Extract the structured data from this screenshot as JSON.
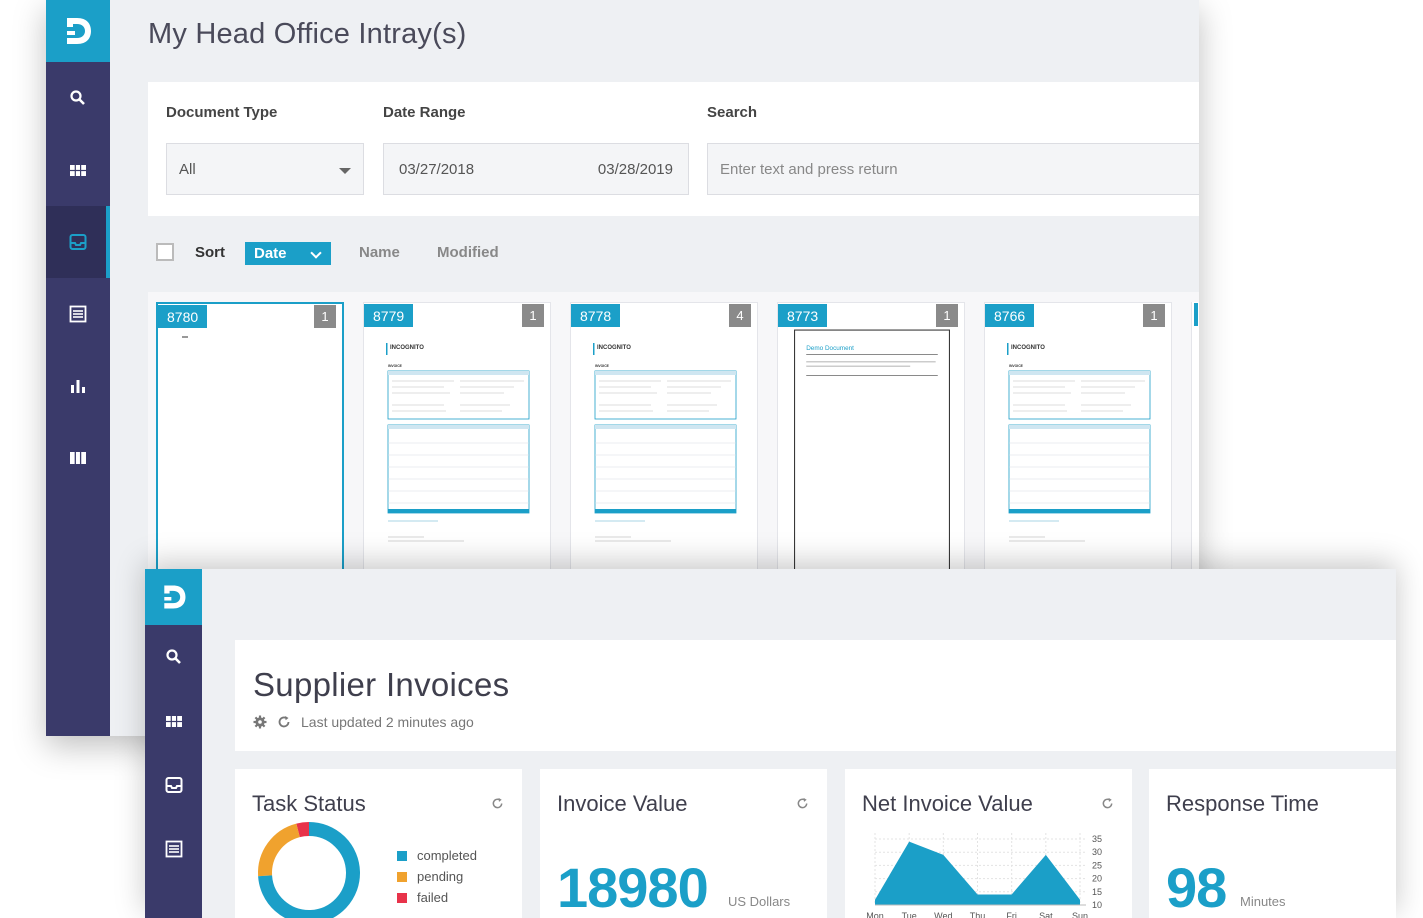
{
  "intray": {
    "title": "My Head Office Intray(s)",
    "filters": {
      "document_type_label": "Document Type",
      "document_type_value": "All",
      "date_range_label": "Date Range",
      "date_from": "03/27/2018",
      "date_to": "03/28/2019",
      "search_label": "Search",
      "search_placeholder": "Enter text and press return"
    },
    "sort": {
      "label": "Sort",
      "selected": "Date",
      "options": [
        "Name",
        "Modified"
      ]
    },
    "documents": [
      {
        "id": "8780",
        "count": "1",
        "selected": true,
        "kind": "blank"
      },
      {
        "id": "8779",
        "count": "1",
        "selected": false,
        "kind": "invoice"
      },
      {
        "id": "8778",
        "count": "4",
        "selected": false,
        "kind": "invoice"
      },
      {
        "id": "8773",
        "count": "1",
        "selected": false,
        "kind": "demo"
      },
      {
        "id": "8766",
        "count": "1",
        "selected": false,
        "kind": "invoice"
      }
    ],
    "thumb_text": {
      "invoice_brand": "INCOGNITO",
      "invoice_heading": "INVOICE",
      "demo_title": "Demo Document"
    }
  },
  "dashboard": {
    "title": "Supplier Invoices",
    "last_updated": "Last updated 2 minutes ago",
    "widgets": {
      "task_status": {
        "title": "Task Status",
        "legend": [
          {
            "label": "completed",
            "color": "#1b9fc8"
          },
          {
            "label": "pending",
            "color": "#f0a22e"
          },
          {
            "label": "failed",
            "color": "#e8334a"
          }
        ]
      },
      "invoice_value": {
        "title": "Invoice Value",
        "value": "18980",
        "unit": "US Dollars"
      },
      "net_invoice_value": {
        "title": "Net Invoice Value",
        "y_ticks": [
          "35",
          "30",
          "25",
          "20",
          "15",
          "10"
        ],
        "x_ticks": [
          "Mon",
          "Tue",
          "Wed",
          "Thu",
          "Fri",
          "Sat",
          "Sun"
        ]
      },
      "response_time": {
        "title": "Response Time",
        "value": "98",
        "unit": "Minutes"
      }
    }
  },
  "chart_data": [
    {
      "type": "pie",
      "title": "Task Status",
      "categories": [
        "completed",
        "pending",
        "failed"
      ],
      "values": [
        74,
        22,
        4
      ],
      "colors": [
        "#1b9fc8",
        "#f0a22e",
        "#e8334a"
      ]
    },
    {
      "type": "area",
      "title": "Net Invoice Value",
      "categories": [
        "Mon",
        "Tue",
        "Wed",
        "Thu",
        "Fri",
        "Sat",
        "Sun"
      ],
      "values": [
        12,
        34,
        29,
        14,
        14,
        29,
        12
      ],
      "ylim": [
        10,
        35
      ],
      "color": "#1b9fc8"
    }
  ],
  "colors": {
    "accent": "#1b9fc8",
    "sidebar": "#3a3a6a"
  }
}
